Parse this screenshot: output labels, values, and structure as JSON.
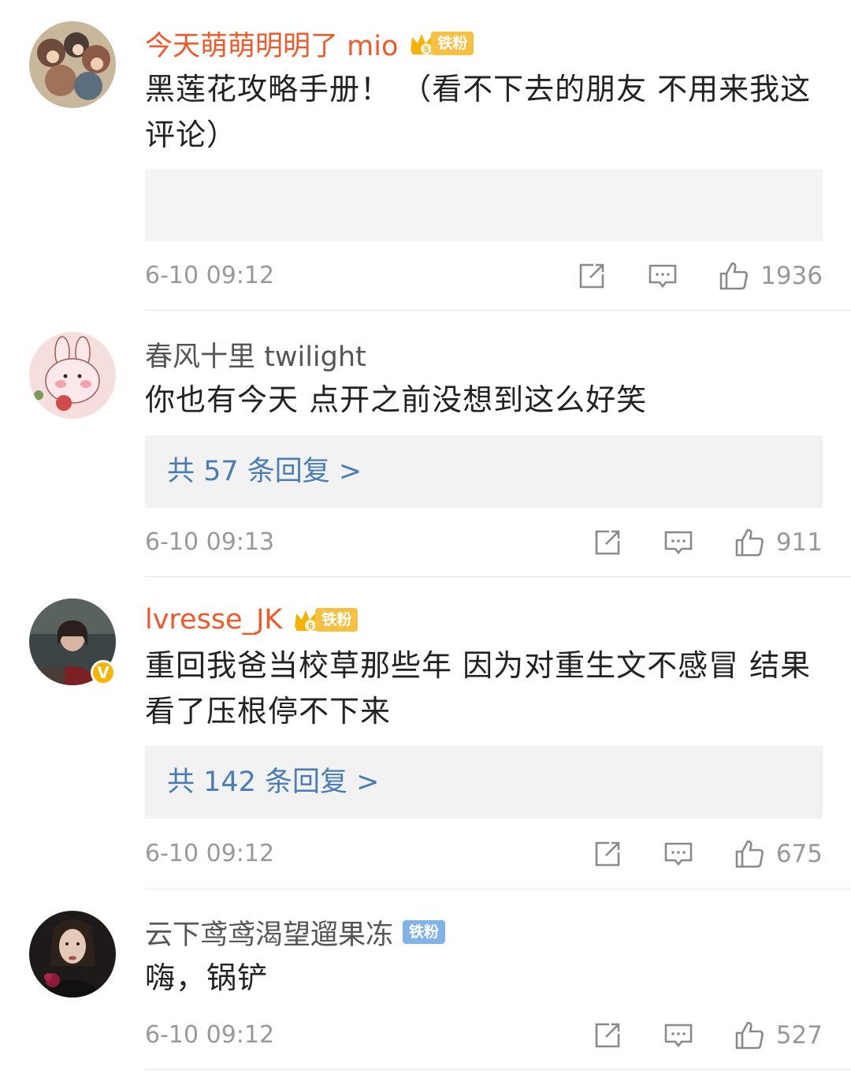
{
  "comments": [
    {
      "username": "今天萌萌明明了 mio",
      "fan_badge": "铁粉",
      "text": "黑莲花攻略手册！ （看不下去的朋友 不用来我这评论）",
      "time": "6-10 09:12",
      "likes": "1936"
    },
    {
      "username": "春风十里 twilight",
      "text": "你也有今天  点开之前没想到这么好笑",
      "replies": "共 57 条回复 >",
      "time": "6-10 09:13",
      "likes": "911"
    },
    {
      "username": "lvresse_JK",
      "fan_badge": "铁粉",
      "verified_badge": "V",
      "text": "重回我爸当校草那些年  因为对重生文不感冒  结果看了压根停不下来",
      "replies": "共 142 条回复 >",
      "time": "6-10 09:12",
      "likes": "675"
    },
    {
      "username": "云下鸢鸢渴望遛果冻",
      "fan_badge": "铁粉",
      "text": "嗨，锅铲",
      "time": "6-10 09:12",
      "likes": "527"
    }
  ],
  "icons": [
    "share-icon",
    "comment-icon",
    "like-icon"
  ],
  "colors": {
    "vip_name": "#f0592a",
    "link": "#4a7db5",
    "meta": "#999999",
    "crown": "#f6c042",
    "fan_blue": "#7fb3ea"
  }
}
